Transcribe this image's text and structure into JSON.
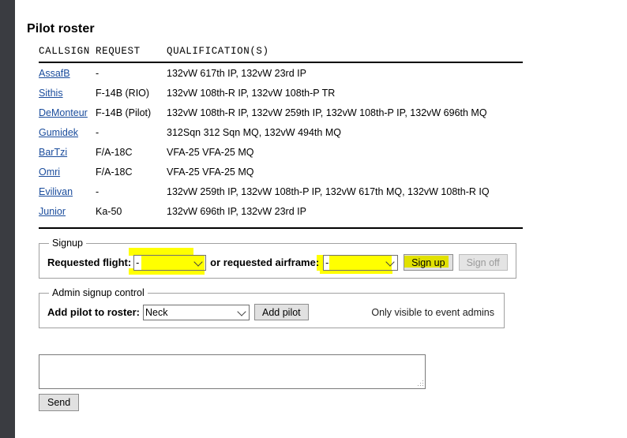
{
  "page": {
    "title": "Pilot roster"
  },
  "roster": {
    "columns": [
      "CALLSIGN",
      "REQUEST",
      "QUALIFICATION(S)"
    ],
    "rows": [
      {
        "callsign": "AssafB",
        "request": "-",
        "qualifications": "132vW 617th IP, 132vW 23rd IP"
      },
      {
        "callsign": "Sithis",
        "request": "F-14B (RIO)",
        "qualifications": "132vW 108th-R IP, 132vW 108th-P TR"
      },
      {
        "callsign": "DeMonteur",
        "request": "F-14B (Pilot)",
        "qualifications": "132vW 108th-R IP, 132vW 259th IP, 132vW 108th-P IP, 132vW 696th MQ"
      },
      {
        "callsign": "Gumidek",
        "request": "-",
        "qualifications": "312Sqn 312 Sqn MQ, 132vW 494th MQ"
      },
      {
        "callsign": "BarTzi",
        "request": "F/A-18C",
        "qualifications": "VFA-25 VFA-25 MQ"
      },
      {
        "callsign": "Omri",
        "request": "F/A-18C",
        "qualifications": "VFA-25 VFA-25 MQ"
      },
      {
        "callsign": "Evilivan",
        "request": "-",
        "qualifications": "132vW 259th IP, 132vW 108th-P IP, 132vW 617th MQ, 132vW 108th-R IQ"
      },
      {
        "callsign": "Junior",
        "request": "Ka-50",
        "qualifications": "132vW 696th IP, 132vW 23rd IP"
      }
    ]
  },
  "signup": {
    "legend": "Signup",
    "flight_label": "Requested flight:",
    "flight_value": "-",
    "airframe_label": "or requested airframe:",
    "airframe_value": "-",
    "sign_up_label": "Sign up",
    "sign_off_label": "Sign off"
  },
  "admin": {
    "legend": "Admin signup control",
    "add_label": "Add pilot to roster:",
    "pilot_value": "Neck",
    "add_button_label": "Add pilot",
    "note": "Only visible to event admins"
  },
  "message": {
    "value": "",
    "send_label": "Send"
  },
  "colors": {
    "highlight": "#ffff00",
    "link": "#1a4c9c",
    "gutter": "#3a3c41"
  }
}
